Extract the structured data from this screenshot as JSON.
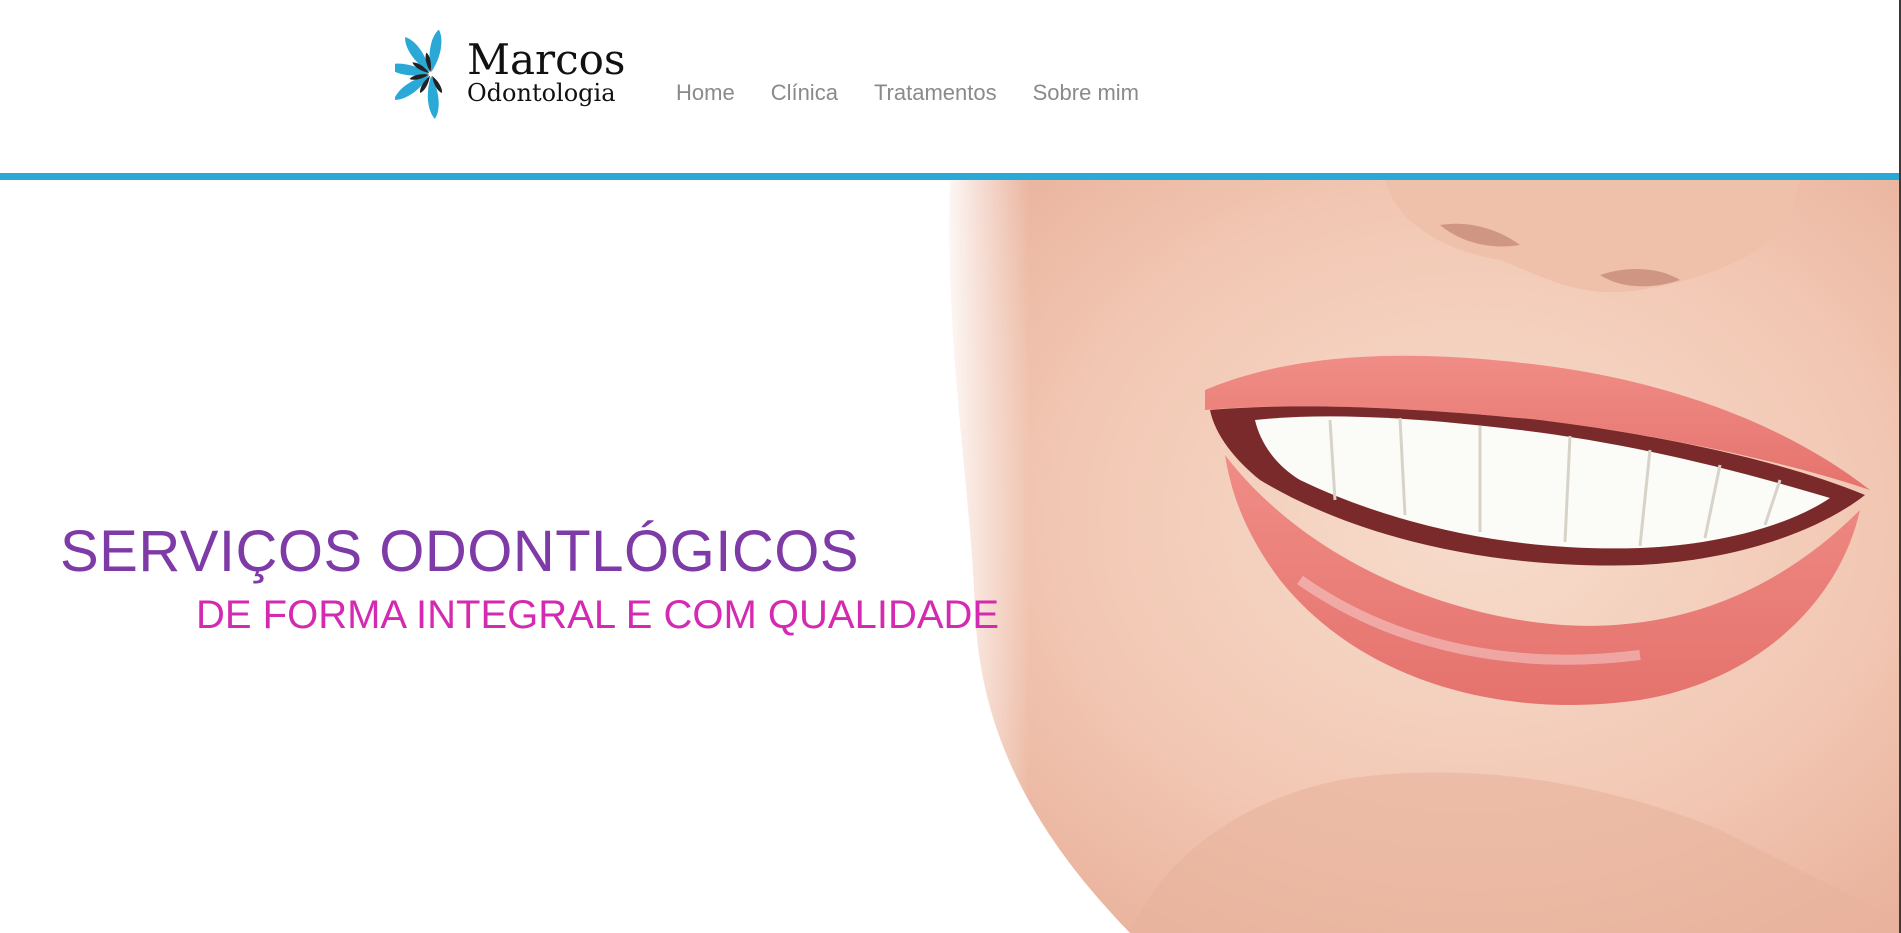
{
  "logo": {
    "title": "Marcos",
    "subtitle": "Odontologia",
    "accent_color": "#2aa8d6",
    "icon": "flower-petals-icon"
  },
  "nav": {
    "items": [
      {
        "label": "Home"
      },
      {
        "label": "Clínica"
      },
      {
        "label": "Tratamentos"
      },
      {
        "label": "Sobre mim"
      }
    ]
  },
  "hero": {
    "headline": "SERVIÇOS ODONTLÓGICOS",
    "subline": "DE FORMA INTEGRAL E COM QUALIDADE",
    "headline_color": "#7e3aa6",
    "subline_color": "#d42ab1",
    "image": "smiling-mouth-photo"
  },
  "colors": {
    "header_bar": "#2aa8d6",
    "nav_text": "#8a8a8a"
  }
}
